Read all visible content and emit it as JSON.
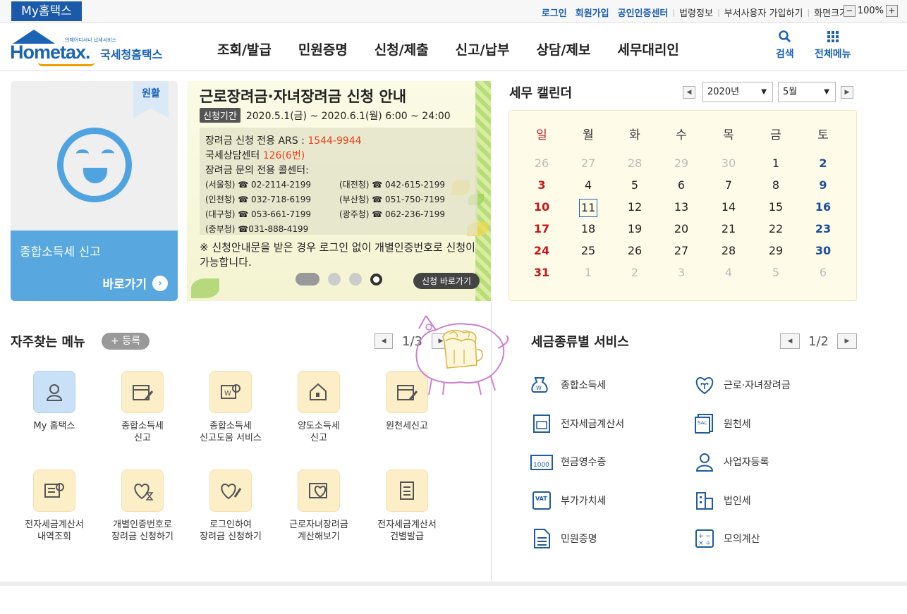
{
  "topbar": {
    "my_hometax": "My홈택스",
    "links": [
      "로그인",
      "회원가입",
      "공인인증센터"
    ],
    "sublinks": [
      "법령정보",
      "부서사용자 가입하기",
      "화면크기"
    ],
    "zoom": "100%",
    "zoom_minus": "−",
    "zoom_plus": "+"
  },
  "header": {
    "logo_small": "언제어디서나 납세서비스",
    "logo_brand": "Hometax.",
    "logo_kr": "국세청홈택스",
    "nav": [
      "조회/발급",
      "민원증명",
      "신청/제출",
      "신고/납부",
      "상담/제보",
      "세무대리인"
    ],
    "search_label": "검색",
    "allmenu_label": "전체메뉴"
  },
  "promo": {
    "badge": "원활",
    "title": "종합소득세 신고",
    "link": "바로가기",
    "link_icon": "›"
  },
  "banner": {
    "title": "근로장려금·자녀장려금 신청 안내",
    "period_tag": "신청기간",
    "period": "2020.5.1(금) ~ 2020.6.1(월) 6:00 ~ 24:00",
    "ars_label": "장려금 신청 전용 ARS : ",
    "ars_num": "1544-9944",
    "center_label": "국세상담센터 ",
    "center_num": "126(6번)",
    "call_label": "장려금 문의 전용 콜센터:",
    "calls": [
      "(서울청) ☎ 02-2114-2199",
      "(대전청) ☎ 042-615-2199",
      "(인천청) ☎ 032-718-6199",
      "(부산청) ☎ 051-750-7199",
      "(대구청) ☎ 053-661-7199",
      "(광주청) ☎ 062-236-7199",
      "(중부청) ☎031-888-4199"
    ],
    "note": "※ 신청안내문을 받은 경우 로그인 없이 개별인증번호로 신청이 가능합니다.",
    "button": "신청 바로가기"
  },
  "calendar": {
    "title": "세무 캘린더",
    "year": "2020년",
    "month": "5월",
    "weekdays": [
      "일",
      "월",
      "화",
      "수",
      "목",
      "금",
      "토"
    ],
    "weeks": [
      [
        "26",
        "27",
        "28",
        "29",
        "30",
        "1",
        "2"
      ],
      [
        "3",
        "4",
        "5",
        "6",
        "7",
        "8",
        "9"
      ],
      [
        "10",
        "11",
        "12",
        "13",
        "14",
        "15",
        "16"
      ],
      [
        "17",
        "18",
        "19",
        "20",
        "21",
        "22",
        "23"
      ],
      [
        "24",
        "25",
        "26",
        "27",
        "28",
        "29",
        "30"
      ],
      [
        "31",
        "1",
        "2",
        "3",
        "4",
        "5",
        "6"
      ]
    ],
    "today": "11"
  },
  "favorites": {
    "title": "자주찾는 메뉴",
    "register": "+ 등록",
    "page": "1/3",
    "items": [
      {
        "label": "My 홈택스",
        "icon": "person-icon"
      },
      {
        "label": "종합소득세\n신고",
        "icon": "calendar-edit-icon"
      },
      {
        "label": "종합소득세\n신고도움 서비스",
        "icon": "won-search-icon"
      },
      {
        "label": "양도소득세\n신고",
        "icon": "house-edit-icon"
      },
      {
        "label": "원천세신고",
        "icon": "calendar-edit-icon"
      },
      {
        "label": "전자세금계산서\n내역조회",
        "icon": "doc-search-icon"
      },
      {
        "label": "개별인증번호로\n장려금 신청하기",
        "icon": "heart-hourglass-icon"
      },
      {
        "label": "로그인하여\n장려금 신청하기",
        "icon": "heart-pen-icon"
      },
      {
        "label": "근로자녀장려금\n계산해보기",
        "icon": "heart-calc-icon"
      },
      {
        "label": "전자세금계산서\n건별발급",
        "icon": "calculator-icon"
      }
    ]
  },
  "taxservice": {
    "title": "세금종류별 서비스",
    "page": "1/2",
    "items": [
      {
        "label": "종합소득세",
        "icon": "money-bag-icon"
      },
      {
        "label": "근로·자녀장려금",
        "icon": "heart-sprout-icon"
      },
      {
        "label": "전자세금계산서",
        "icon": "invoice-icon"
      },
      {
        "label": "원천세",
        "icon": "salary-doc-icon"
      },
      {
        "label": "현금영수증",
        "icon": "cash-receipt-icon"
      },
      {
        "label": "사업자등록",
        "icon": "person-icon"
      },
      {
        "label": "부가가치세",
        "icon": "vat-icon"
      },
      {
        "label": "법인세",
        "icon": "building-icon"
      },
      {
        "label": "민원증명",
        "icon": "document-icon"
      },
      {
        "label": "모의계산",
        "icon": "calculator-icon"
      }
    ],
    "cash_icon_text": "1000",
    "vat_icon_text": "VAT"
  },
  "colors": {
    "brand": "#1b64b3",
    "promo_blue": "#58a8df",
    "sunday": "#c4161c",
    "saturday": "#1b4f9a",
    "highlight": "#e8411a"
  }
}
